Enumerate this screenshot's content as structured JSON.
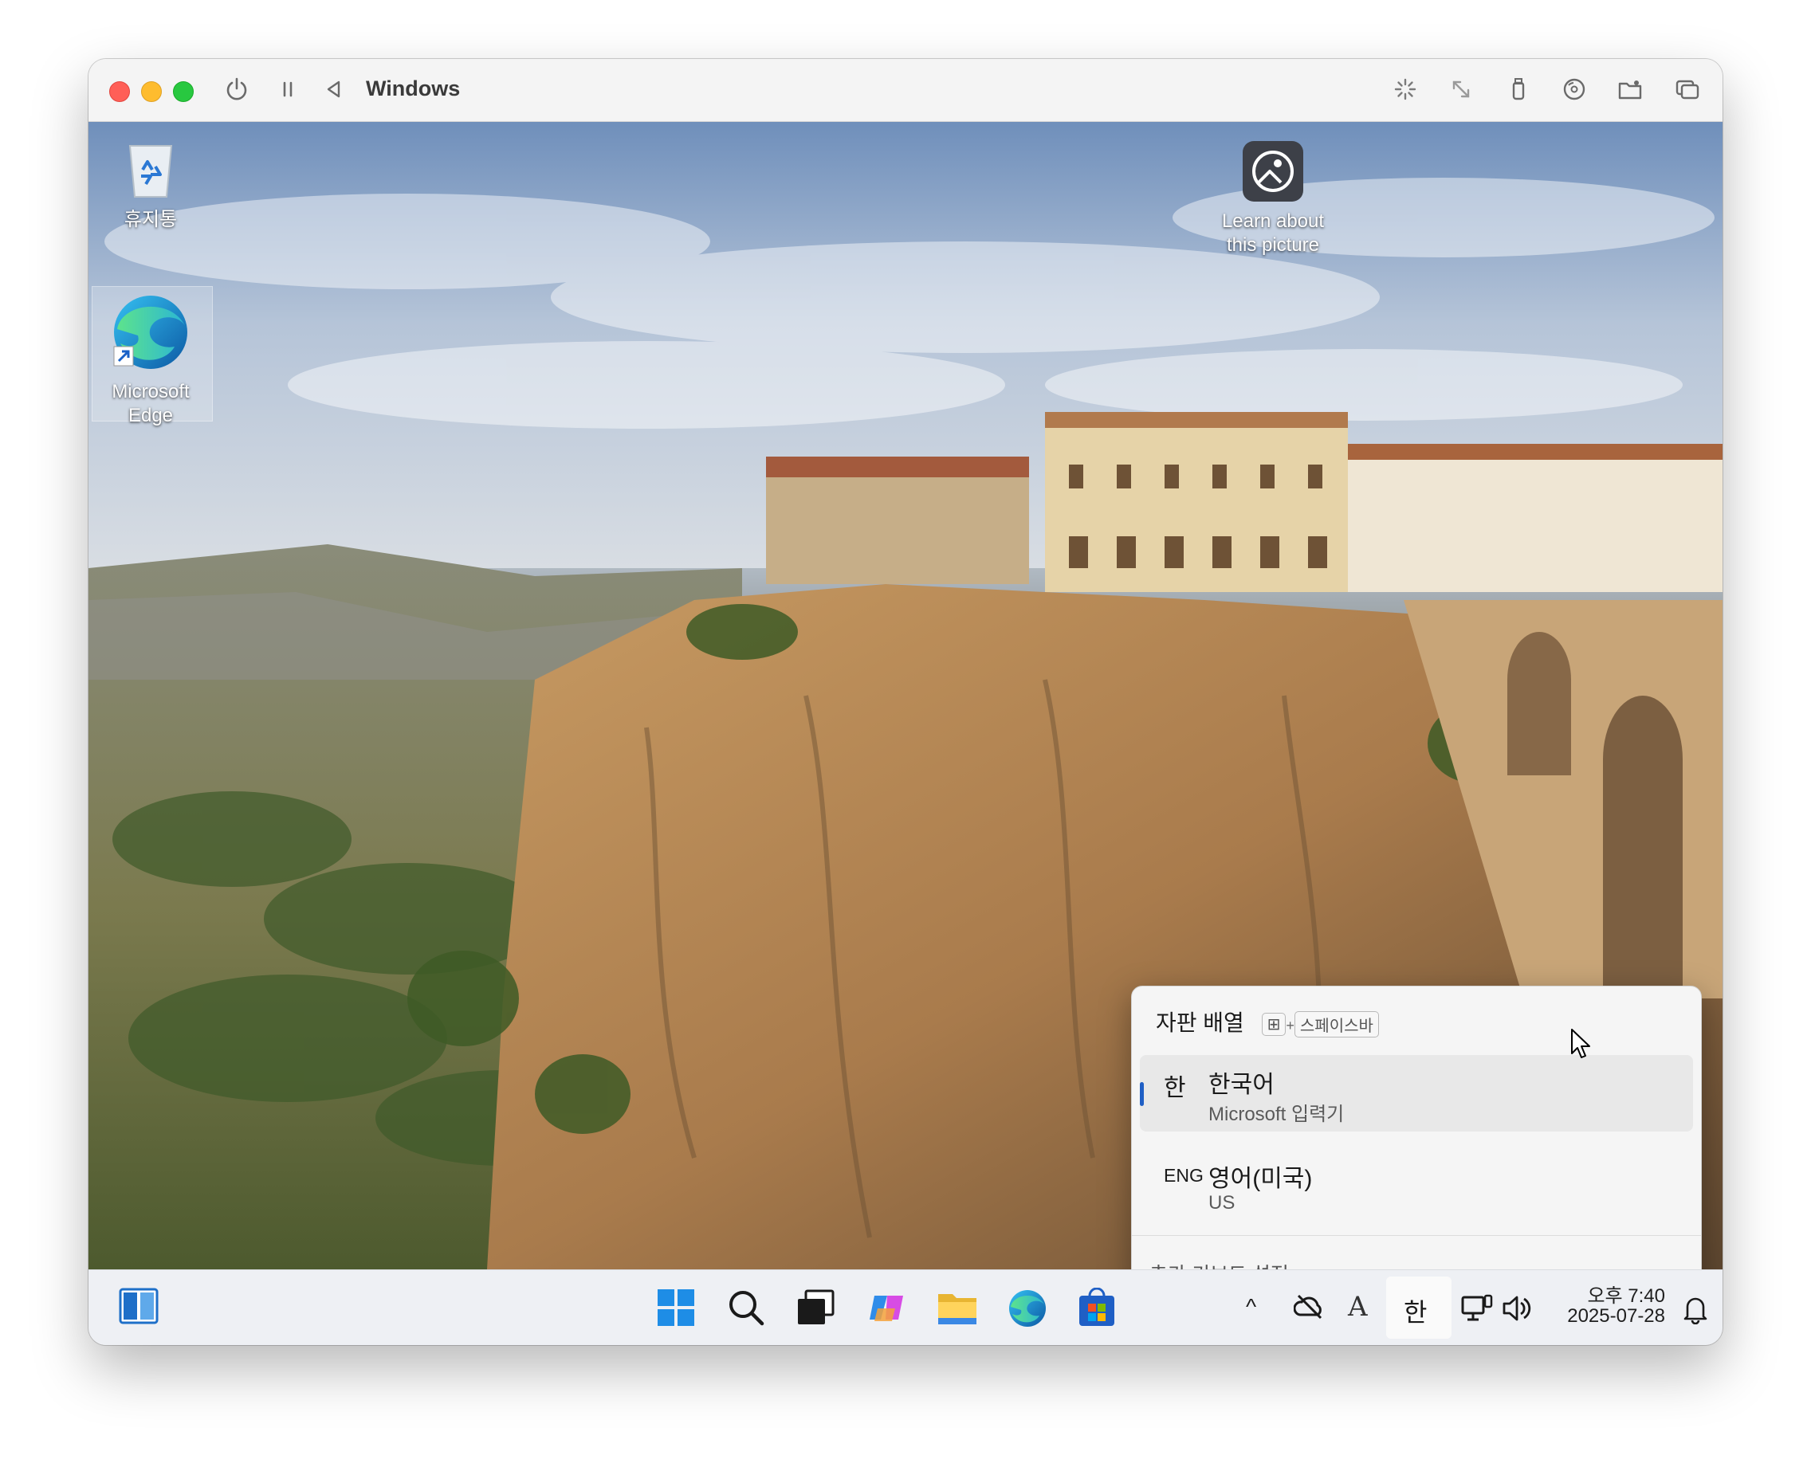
{
  "window": {
    "title": "Windows",
    "toolbar_left_icons": [
      "power-icon",
      "pause-icon",
      "back-icon"
    ],
    "toolbar_right_icons": [
      "brightness-icon",
      "resize-icon",
      "usb-icon",
      "disc-icon",
      "shared-folder-icon",
      "windows-icon"
    ]
  },
  "desktop": {
    "icons": [
      {
        "name": "recycle-bin",
        "label": "휴지통"
      },
      {
        "name": "microsoft-edge",
        "label": "Microsoft Edge",
        "line1": "Microsoft",
        "line2": "Edge"
      },
      {
        "name": "learn-about-picture",
        "line1": "Learn about",
        "line2": "this picture"
      }
    ]
  },
  "ime_popup": {
    "header": "자판 배열",
    "shortcut_key": "⊞",
    "shortcut_plus": "+",
    "shortcut_space": "스페이스바",
    "items": [
      {
        "short": "한",
        "name": "한국어",
        "sub": "Microsoft 입력기",
        "selected": true
      },
      {
        "short": "ENG",
        "name": "영어(미국)",
        "sub": "US",
        "selected": false
      }
    ],
    "settings_link": "추가 키보드 설정"
  },
  "taskbar": {
    "apps": [
      "widgets-icon",
      "start-icon",
      "search-icon",
      "task-view-icon",
      "copilot-icon",
      "file-explorer-icon",
      "edge-icon",
      "store-icon"
    ],
    "tray": {
      "chevron": "^",
      "font_mode": "A",
      "ime_mode": "한",
      "time": "오후 7:40",
      "date": "2025-07-28"
    }
  },
  "colors": {
    "accent": "#1f5fc5",
    "close": "#ff5f57",
    "minimize": "#febc2e",
    "maximize": "#28c840"
  }
}
